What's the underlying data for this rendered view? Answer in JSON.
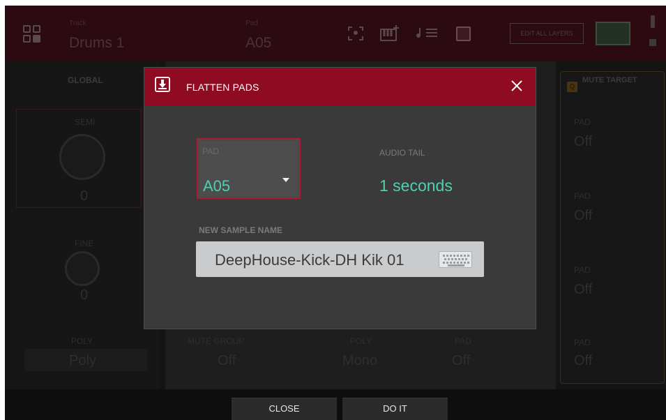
{
  "topbar": {
    "track_label": "Track",
    "track_name": "Drums 1",
    "pad_label": "Pad",
    "pad_name": "A05",
    "edit_all_layers": "EDIT ALL LAYERS"
  },
  "background": {
    "global_header": "GLOBAL",
    "semi_label": "SEMI",
    "semi_value": "0",
    "fine_label": "FINE",
    "fine_value": "0",
    "poly_label": "POLY",
    "poly_value": "Poly",
    "mute_group_label": "MUTE GROUP",
    "mute_group_value": "Off",
    "pad_poly_label": "POLY",
    "pad_poly_value": "Mono",
    "pad_label": "PAD",
    "pad_value": "Off",
    "mute_target_header": "MUTE TARGET",
    "q_badge": "Q",
    "mute_targets": [
      {
        "label": "PAD",
        "value": "Off"
      },
      {
        "label": "PAD",
        "value": "Off"
      },
      {
        "label": "PAD",
        "value": "Off"
      },
      {
        "label": "PAD",
        "value": "Off"
      }
    ]
  },
  "dialog": {
    "title": "FLATTEN PADS",
    "icon": "flatten-download-icon",
    "pad_label": "PAD",
    "pad_value": "A05",
    "audio_tail_label": "AUDIO TAIL",
    "audio_tail_value": "1 seconds",
    "new_sample_name_label": "NEW SAMPLE NAME",
    "new_sample_name_value": "DeepHouse-Kick-DH Kik 01",
    "keyboard_icon": "keyboard-icon"
  },
  "footer": {
    "close_label": "CLOSE",
    "do_it_label": "DO IT"
  },
  "colors": {
    "header_red": "#8e0b22",
    "accent_teal": "#4fd0b0",
    "dialog_bg": "#3a3a3b"
  }
}
